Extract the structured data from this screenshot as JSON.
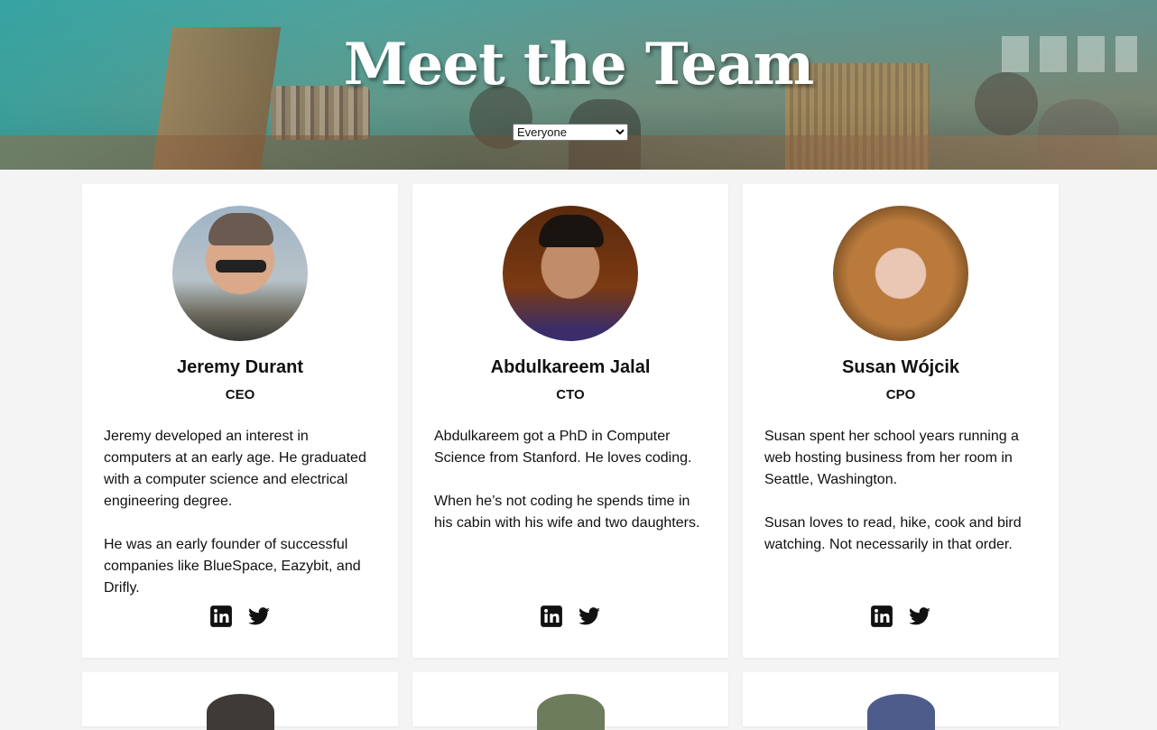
{
  "hero": {
    "title": "Meet the Team",
    "filter": {
      "selected": "Everyone"
    }
  },
  "team": [
    {
      "name": "Jeremy Durant",
      "role": "CEO",
      "bio": [
        "Jeremy developed an interest in computers at an early age. He graduated with a computer science and electrical engineering degree.",
        "He was an early founder of successful companies like BlueSpace, Eazybit, and Drifly."
      ]
    },
    {
      "name": "Abdulkareem Jalal",
      "role": "CTO",
      "bio": [
        "Abdulkareem got a PhD in Computer Science from Stanford. He loves coding.",
        "When he’s not coding he spends time in his cabin with his wife and two daughters."
      ]
    },
    {
      "name": "Susan Wójcik",
      "role": "CPO",
      "bio": [
        "Susan spent her school years running a web hosting business from her room in Seattle, Washington.",
        "Susan loves to read, hike, cook and bird watching. Not necessarily in that order."
      ]
    }
  ],
  "icons": {
    "linkedin": "linkedin-icon",
    "twitter": "twitter-icon"
  },
  "colors": {
    "hero_tint": "#2aa8a8",
    "page_bg": "#f4f4f4",
    "card_bg": "#ffffff",
    "text": "#111111"
  }
}
